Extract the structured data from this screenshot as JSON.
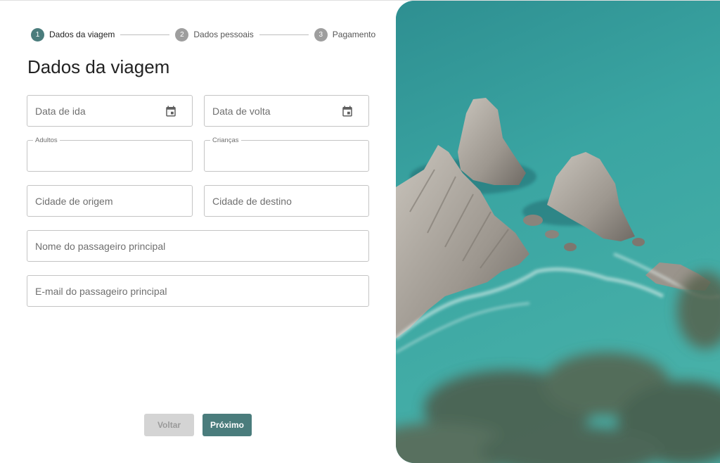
{
  "stepper": {
    "steps": [
      {
        "number": "1",
        "label": "Dados da viagem"
      },
      {
        "number": "2",
        "label": "Dados pessoais"
      },
      {
        "number": "3",
        "label": "Pagamento"
      }
    ],
    "active_step": 1
  },
  "form": {
    "title": "Dados da viagem",
    "departure_date": {
      "placeholder": "Data de ida",
      "icon": "calendar-icon"
    },
    "return_date": {
      "placeholder": "Data de volta",
      "icon": "calendar-icon"
    },
    "adults": {
      "label": "Adultos",
      "value": ""
    },
    "children": {
      "label": "Crianças",
      "value": ""
    },
    "origin_city": {
      "placeholder": "Cidade de origem"
    },
    "destination_city": {
      "placeholder": "Cidade de destino"
    },
    "main_passenger_name": {
      "placeholder": "Nome do passageiro principal"
    },
    "main_passenger_email": {
      "placeholder": "E-mail do passageiro principal"
    }
  },
  "actions": {
    "back_label": "Voltar",
    "next_label": "Próximo"
  },
  "colors": {
    "accent": "#4a7c7c",
    "inactive_step": "#9e9e9e",
    "disabled_button": "#d4d4d4"
  }
}
